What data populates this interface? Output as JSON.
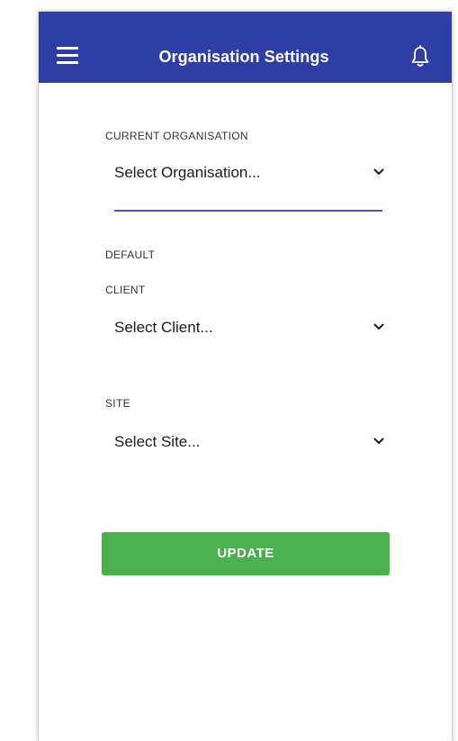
{
  "appbar": {
    "title": "Organisation Settings",
    "menu_icon": "hamburger-menu-icon",
    "notification_icon": "bell-icon",
    "color": "#2f3ea6"
  },
  "form": {
    "current_organisation": {
      "label": "CURRENT ORGANISATION",
      "value": "Select Organisation..."
    },
    "default_label": "DEFAULT",
    "client": {
      "label": "CLIENT",
      "value": "Select Client..."
    },
    "site": {
      "label": "SITE",
      "value": "Select Site..."
    },
    "dropdown_icon": "chevron-down-icon",
    "focus_underline_color": "#4a56b5"
  },
  "actions": {
    "update_label": "UPDATE",
    "update_color": "#4caf50"
  }
}
